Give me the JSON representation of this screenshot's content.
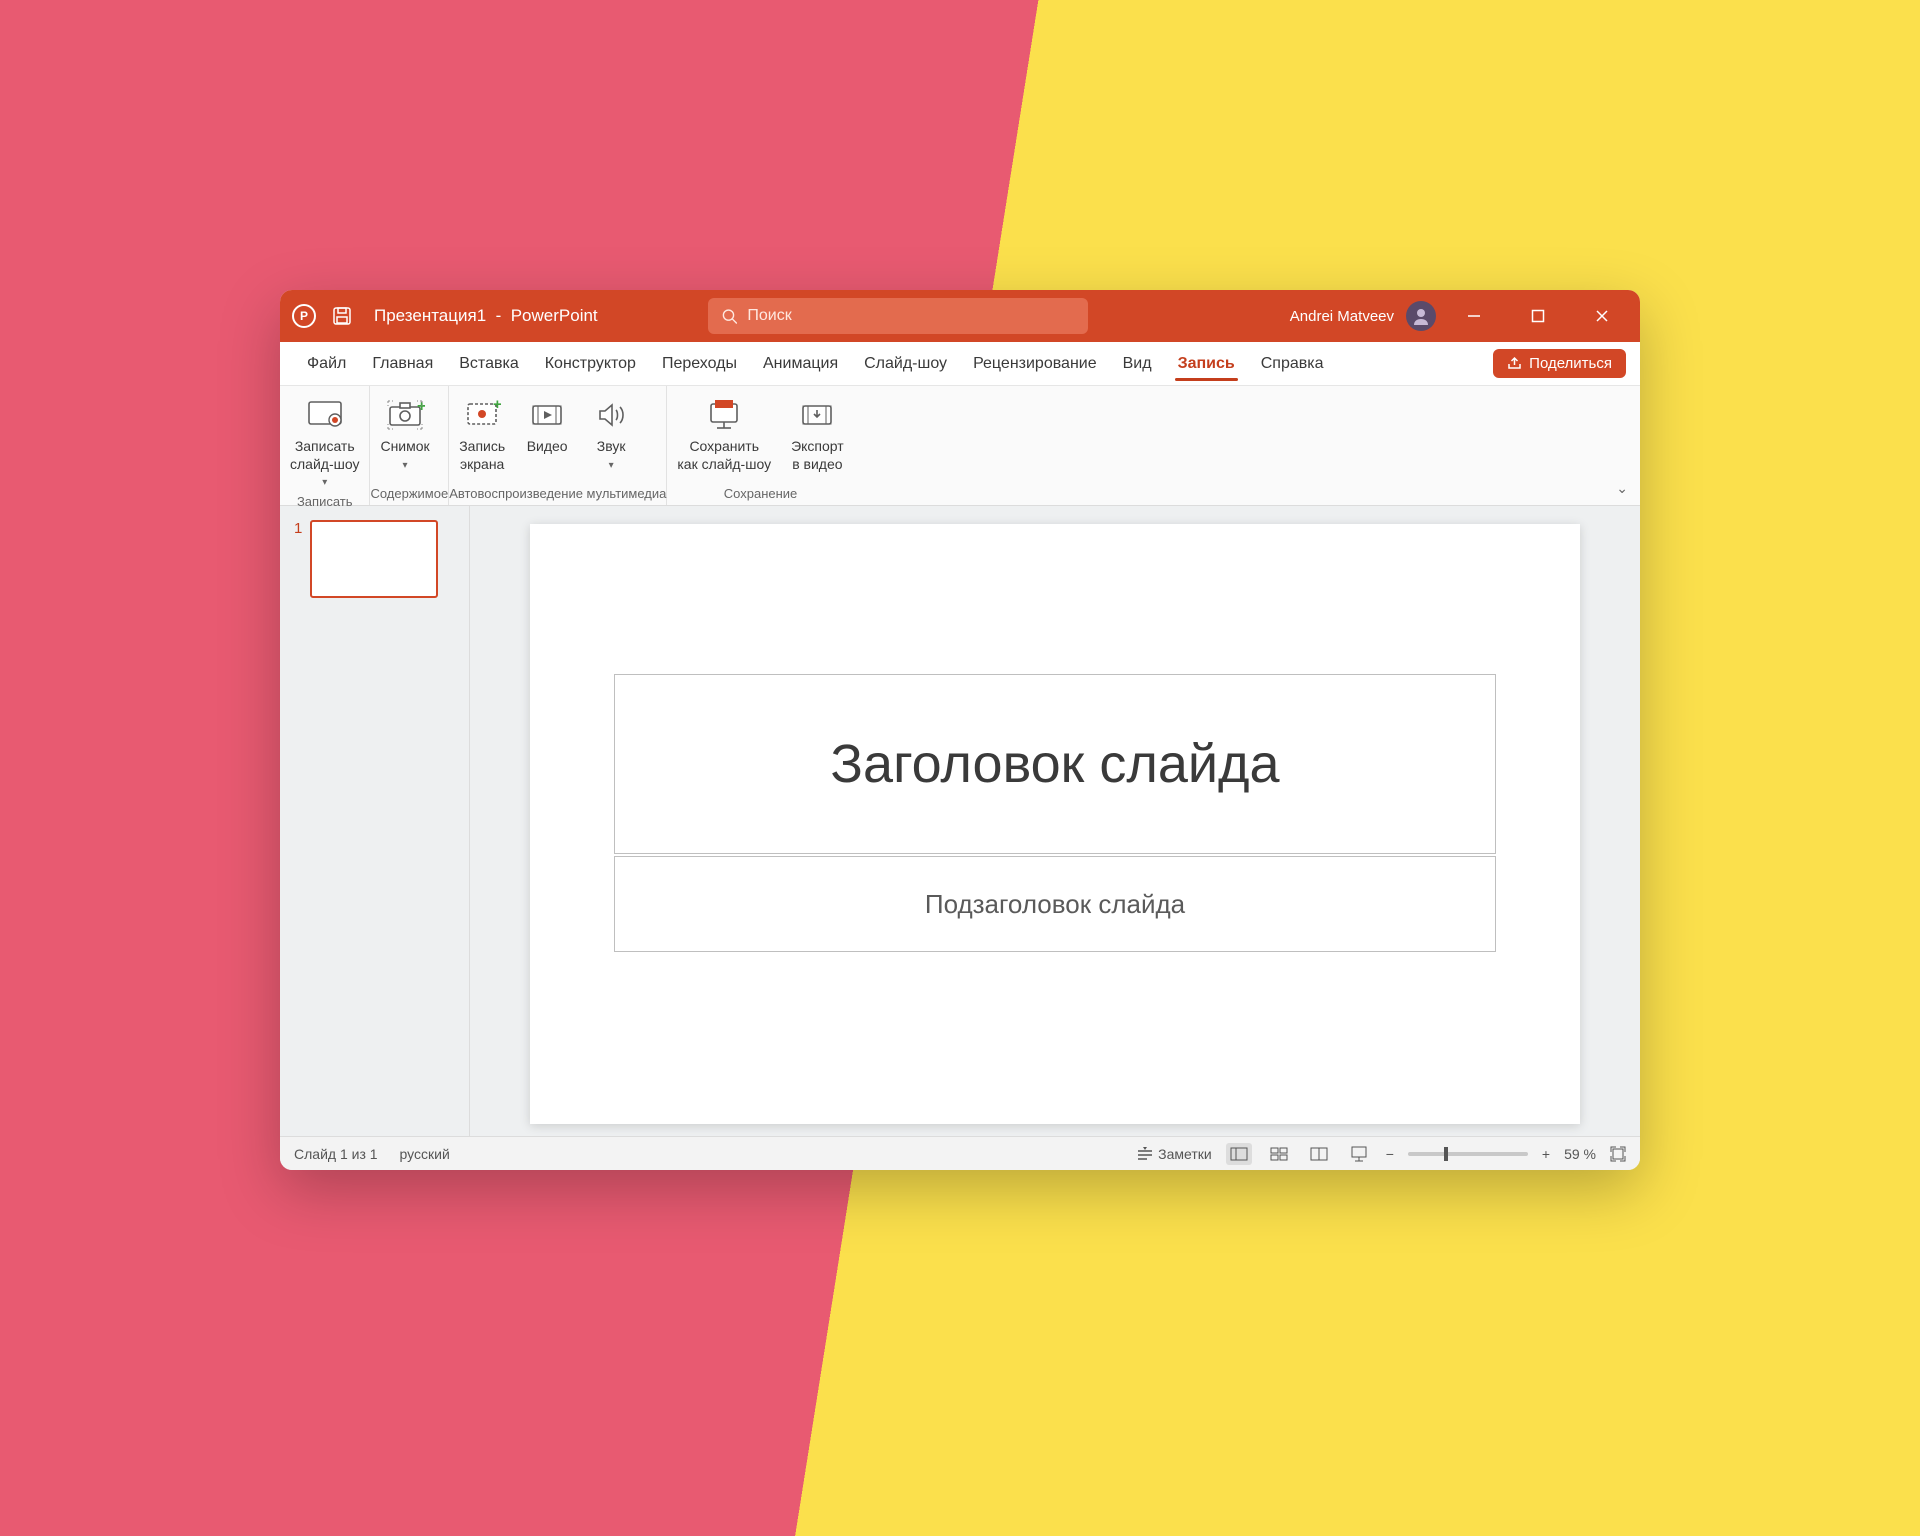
{
  "titlebar": {
    "doc_title": "Презентация1",
    "app_name": "PowerPoint",
    "search_placeholder": "Поиск",
    "user_name": "Andrei Matveev"
  },
  "tabs": {
    "items": [
      "Файл",
      "Главная",
      "Вставка",
      "Конструктор",
      "Переходы",
      "Анимация",
      "Слайд-шоу",
      "Рецензирование",
      "Вид",
      "Запись",
      "Справка"
    ],
    "active": "Запись",
    "share_label": "Поделиться"
  },
  "ribbon": {
    "groups": [
      {
        "label": "Записать",
        "items": [
          {
            "label": "Записать\nслайд-шоу",
            "drop": true
          }
        ]
      },
      {
        "label": "Содержимое",
        "items": [
          {
            "label": "Снимок",
            "drop": true
          }
        ]
      },
      {
        "label": "Автовоспроизведение мультимедиа",
        "items": [
          {
            "label": "Запись\nэкрана"
          },
          {
            "label": "Видео"
          },
          {
            "label": "Звук",
            "drop": true
          }
        ]
      },
      {
        "label": "Сохранение",
        "items": [
          {
            "label": "Сохранить\nкак слайд-шоу"
          },
          {
            "label": "Экспорт\nв видео"
          }
        ]
      }
    ]
  },
  "slide": {
    "number": "1",
    "title_placeholder": "Заголовок слайда",
    "subtitle_placeholder": "Подзаголовок слайда"
  },
  "status": {
    "slide_counter": "Слайд 1 из 1",
    "language": "русский",
    "notes_label": "Заметки",
    "zoom": "59 %"
  }
}
